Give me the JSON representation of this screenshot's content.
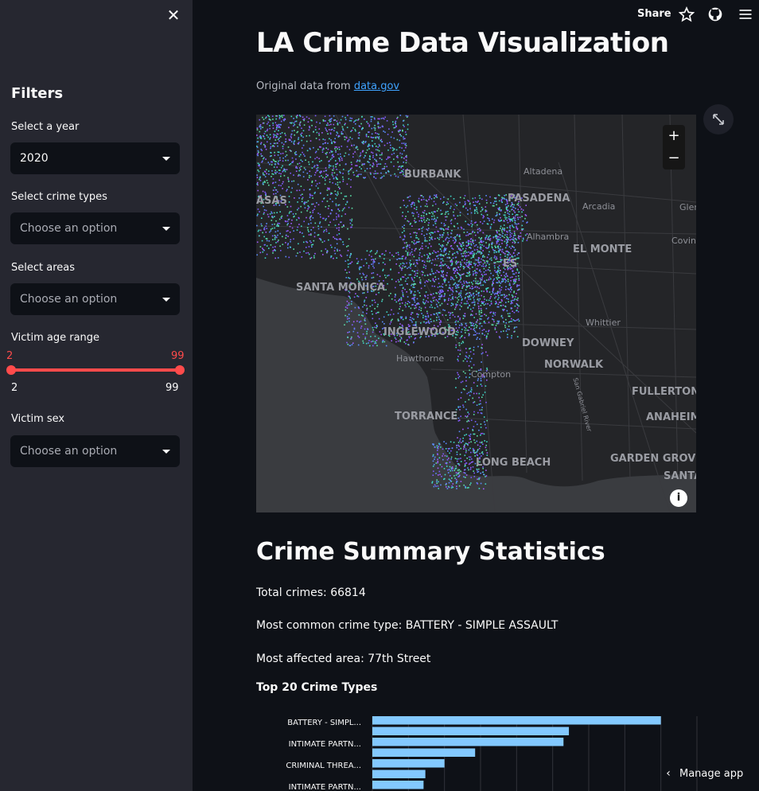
{
  "sidebar": {
    "title": "Filters",
    "year_label": "Select a year",
    "year_value": "2020",
    "crime_label": "Select crime types",
    "crime_placeholder": "Choose an option",
    "area_label": "Select areas",
    "area_placeholder": "Choose an option",
    "age_label": "Victim age range",
    "age_min": "2",
    "age_max": "99",
    "age_range_min": "2",
    "age_range_max": "99",
    "sex_label": "Victim sex",
    "sex_placeholder": "Choose an option"
  },
  "topbar": {
    "share_label": "Share"
  },
  "main": {
    "title": "LA Crime Data Visualization",
    "source_prefix": "Original data from ",
    "source_link": "data.gov",
    "summary_title": "Crime Summary Statistics",
    "total_crimes": "Total crimes: 66814",
    "common_type": "Most common crime type: BATTERY - SIMPLE ASSAULT",
    "affected_area": "Most affected area: 77th Street",
    "chart_title": "Top 20 Crime Types"
  },
  "map": {
    "cities": [
      {
        "name": "BURBANK",
        "big": true
      },
      {
        "name": "Altadena",
        "big": false
      },
      {
        "name": "PASADENA",
        "big": true
      },
      {
        "name": "Arcadia",
        "big": false
      },
      {
        "name": "Glen",
        "big": false
      },
      {
        "name": "ASAS",
        "big": true
      },
      {
        "name": "Alhambra",
        "big": false
      },
      {
        "name": "Covina",
        "big": false
      },
      {
        "name": "EL MONTE",
        "big": true
      },
      {
        "name": "ES",
        "big": true
      },
      {
        "name": "SANTA MONICA",
        "big": true
      },
      {
        "name": "Whittier",
        "big": false
      },
      {
        "name": "INGLEWOOD",
        "big": true
      },
      {
        "name": "DOWNEY",
        "big": true
      },
      {
        "name": "Hawthorne",
        "big": false
      },
      {
        "name": "NORWALK",
        "big": true
      },
      {
        "name": "Compton",
        "big": false
      },
      {
        "name": "FULLERTON",
        "big": true
      },
      {
        "name": "TORRANCE",
        "big": true
      },
      {
        "name": "ANAHEIM",
        "big": true
      },
      {
        "name": "LONG BEACH",
        "big": true
      },
      {
        "name": "GARDEN GROVE",
        "big": true
      },
      {
        "name": "SANTA",
        "big": true
      },
      {
        "name": "San Gabriel River",
        "big": false
      }
    ]
  },
  "manage": {
    "label": "Manage app"
  },
  "chart_data": {
    "type": "bar",
    "orientation": "horizontal",
    "title": "Top 20 Crime Types",
    "categories": [
      "BATTERY - SIMPL...",
      "",
      "INTIMATE PARTN...",
      "",
      "CRIMINAL THREA...",
      "",
      "INTIMATE PARTN..."
    ],
    "values": [
      8000,
      5450,
      5300,
      2850,
      2000,
      1470,
      1420
    ],
    "xlim": [
      0,
      9000
    ],
    "grid": true,
    "color": "#83c9ff"
  },
  "colors": {
    "accent": "#ff4b4b",
    "link": "#3fa3ff",
    "bar": "#83c9ff"
  }
}
